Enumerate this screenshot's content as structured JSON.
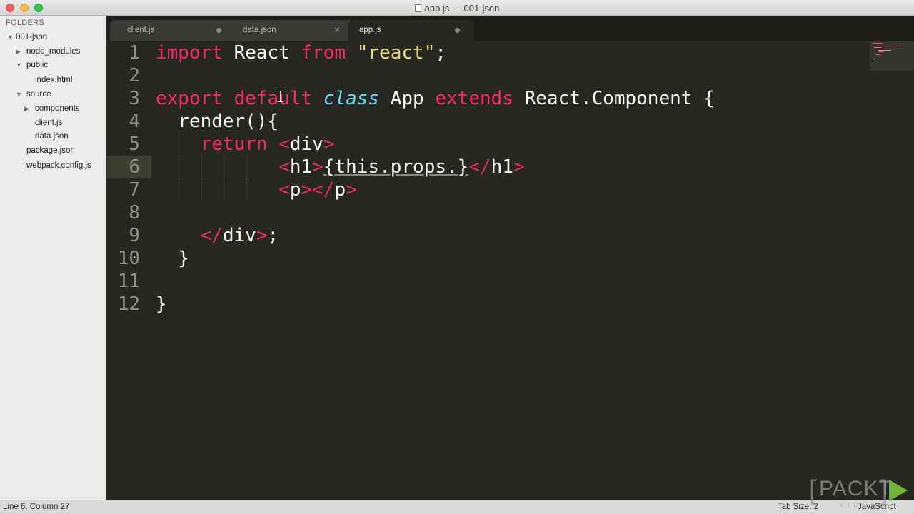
{
  "window": {
    "title": "app.js — 001-json"
  },
  "sidebar": {
    "header": "FOLDERS",
    "items": [
      {
        "label": "001-json",
        "state": "expanded"
      },
      {
        "label": "node_modules",
        "state": "collapsed"
      },
      {
        "label": "public",
        "state": "expanded"
      },
      {
        "label": "index.html",
        "state": "file"
      },
      {
        "label": "source",
        "state": "expanded"
      },
      {
        "label": "components",
        "state": "collapsed"
      },
      {
        "label": "client.js",
        "state": "file"
      },
      {
        "label": "data.json",
        "state": "file"
      },
      {
        "label": "package.json",
        "state": "file"
      },
      {
        "label": "webpack.config.js",
        "state": "file"
      }
    ]
  },
  "tabs": [
    {
      "label": "client.js",
      "marker": "dot"
    },
    {
      "label": "data.json",
      "marker": "close"
    },
    {
      "label": "app.js",
      "marker": "dot",
      "active": true
    }
  ],
  "editor": {
    "lines": [
      {
        "n": "1"
      },
      {
        "n": "2"
      },
      {
        "n": "3"
      },
      {
        "n": "4"
      },
      {
        "n": "5"
      },
      {
        "n": "6"
      },
      {
        "n": "7"
      },
      {
        "n": "8"
      },
      {
        "n": "9"
      },
      {
        "n": "10"
      },
      {
        "n": "11"
      },
      {
        "n": "12"
      }
    ],
    "tokens": {
      "l1_import": "import",
      "l1_react": " React ",
      "l1_from": "from",
      "l1_sp": " ",
      "l1_str": "\"react\"",
      "l1_semi": ";",
      "l3_export": "export",
      "l3_sp1": " ",
      "l3_default": "default",
      "l3_sp2": " ",
      "l3_class": "class",
      "l3_app": " App ",
      "l3_extends": "extends",
      "l3_rest": " React.Component {",
      "l4": "  render(){",
      "l5_ind": "    ",
      "l5_return": "return",
      "l5_sp": " ",
      "l5_lt": "<",
      "l5_div": "div",
      "l5_gt": ">",
      "l6_ind": "           ",
      "l6_lt": "<",
      "l6_h1": "h1",
      "l6_gt": ">",
      "l6_expr": "{this.props.}",
      "l6_close_lt": "</",
      "l6_close_h1": "h1",
      "l6_close_gt": ">",
      "l7_ind": "           ",
      "l7_lt": "<",
      "l7_p": "p",
      "l7_gt": ">",
      "l7_close_lt": "</",
      "l7_close_p": "p",
      "l7_close_gt": ">",
      "l9_ind": "    ",
      "l9_lt": "</",
      "l9_div": "div",
      "l9_gt": ">",
      "l9_semi": ";",
      "l10": "  }",
      "l12": "}"
    }
  },
  "statusbar": {
    "position": "Line 6, Column 27",
    "tab_size": "Tab Size: 2",
    "syntax": "JavaScript"
  },
  "watermark": {
    "text": "PACKT",
    "sub": "VIDEO"
  },
  "colors": {
    "keyword": "#f92672",
    "string": "#e6db74",
    "storage_type": "#66d9ef",
    "foreground": "#f8f8f2",
    "background": "#272822",
    "watermark_play": "#6fb33a"
  }
}
